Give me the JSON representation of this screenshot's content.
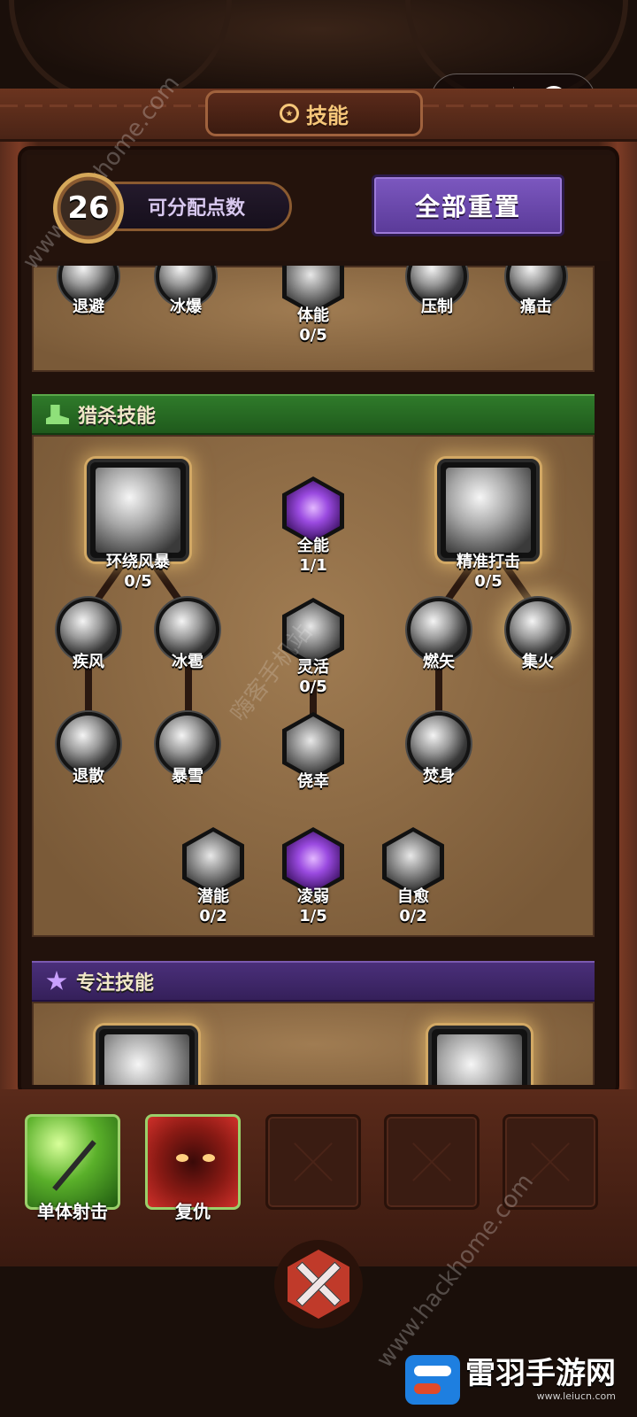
{
  "header": {
    "title": "技能"
  },
  "capsule": {
    "more_icon": "more-dots-icon",
    "close_icon": "target-close-icon"
  },
  "points": {
    "value": "26",
    "label": "可分配点数"
  },
  "reset_button": {
    "label": "全部重置"
  },
  "top_row": [
    {
      "name": "退避"
    },
    {
      "name": "冰爆"
    },
    {
      "name": "体能",
      "progress": "0/5"
    },
    {
      "name": "压制"
    },
    {
      "name": "痛击"
    }
  ],
  "hunt_section": {
    "title": "猎杀技能",
    "nodes": {
      "huanrao": {
        "name": "环绕风暴",
        "progress": "0/5"
      },
      "quanneng": {
        "name": "全能",
        "progress": "1/1"
      },
      "jingzhun": {
        "name": "精准打击",
        "progress": "0/5"
      },
      "jifeng": {
        "name": "疾风"
      },
      "bingbao": {
        "name": "冰雹"
      },
      "linghuo": {
        "name": "灵活",
        "progress": "0/5"
      },
      "ranshi": {
        "name": "燃矢"
      },
      "jihuo": {
        "name": "集火"
      },
      "tuisan": {
        "name": "退散"
      },
      "baoxue": {
        "name": "暴雪"
      },
      "jiaoxing": {
        "name": "侥幸"
      },
      "fenshen": {
        "name": "焚身"
      },
      "qianneng": {
        "name": "潜能",
        "progress": "0/2"
      },
      "lingruo": {
        "name": "凌弱",
        "progress": "1/5"
      },
      "ziyu": {
        "name": "自愈",
        "progress": "0/2"
      }
    }
  },
  "focus_section": {
    "title": "专注技能"
  },
  "equipped": [
    {
      "name": "单体射击"
    },
    {
      "name": "复仇"
    }
  ],
  "watermarks": {
    "hackhome": "www.hackhome.com",
    "hackhome_bottom": "www.hackhome.com",
    "cn": "嗨客手机站"
  },
  "logo": {
    "name": "雷羽手游网",
    "url": "www.leiucn.com"
  }
}
